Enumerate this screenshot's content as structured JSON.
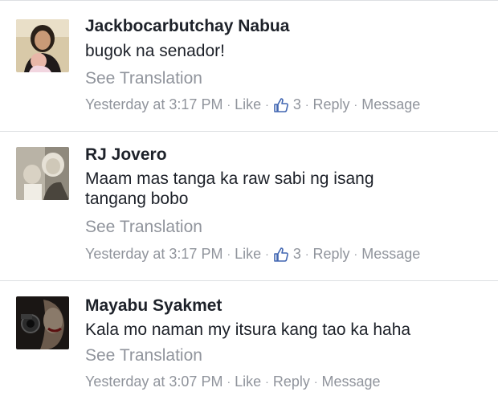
{
  "comments": [
    {
      "author": "Jackbocarbutchay Nabua",
      "text": "bugok na senador!",
      "translate": "See Translation",
      "time": "Yesterday at 3:17 PM",
      "like": "Like",
      "likes": "3",
      "reply": "Reply",
      "message": "Message"
    },
    {
      "author": "RJ Jovero",
      "text": "Maam mas tanga ka raw sabi ng isang tangang bobo",
      "translate": "See Translation",
      "time": "Yesterday at 3:17 PM",
      "like": "Like",
      "likes": "3",
      "reply": "Reply",
      "message": "Message"
    },
    {
      "author": "Mayabu Syakmet",
      "text": "Kala mo naman my itsura kang tao ka haha",
      "translate": "See Translation",
      "time": "Yesterday at 3:07 PM",
      "like": "Like",
      "reply": "Reply",
      "message": "Message"
    }
  ],
  "separator": "·",
  "colors": {
    "text": "#1d2129",
    "muted": "#90949c",
    "like_icon": "#4267b2",
    "divider": "#dddfe2"
  }
}
